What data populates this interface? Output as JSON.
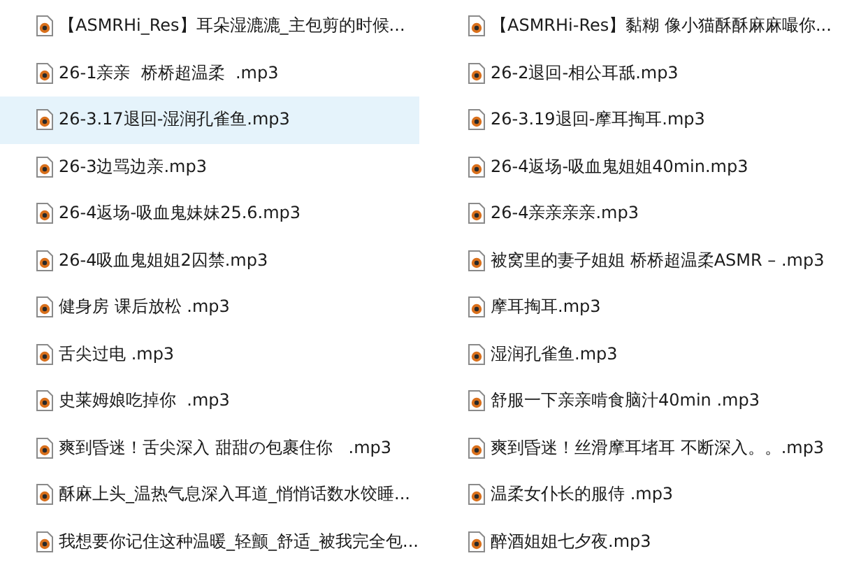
{
  "files": [
    {
      "name": "【ASMRHi_Res】耳朵湿漉漉_主包剪的时候...",
      "selected": false
    },
    {
      "name": "【ASMRHi-Res】黏糊 像小猫酥酥麻麻嘬你...",
      "selected": false
    },
    {
      "name": "26-1亲亲  桥桥超温柔  .mp3",
      "selected": false
    },
    {
      "name": "26-2退回-相公耳舐.mp3",
      "selected": false
    },
    {
      "name": "26-3.17退回-湿润孔雀鱼.mp3",
      "selected": true
    },
    {
      "name": "26-3.19退回-摩耳掏耳.mp3",
      "selected": false
    },
    {
      "name": "26-3边骂边亲.mp3",
      "selected": false
    },
    {
      "name": "26-4返场-吸血鬼姐姐40min.mp3",
      "selected": false
    },
    {
      "name": "26-4返场-吸血鬼妹妹25.6.mp3",
      "selected": false
    },
    {
      "name": "26-4亲亲亲亲.mp3",
      "selected": false
    },
    {
      "name": "26-4吸血鬼姐姐2囚禁.mp3",
      "selected": false
    },
    {
      "name": "被窝里的妻子姐姐 桥桥超温柔ASMR – .mp3",
      "selected": false
    },
    {
      "name": "健身房 课后放松 .mp3",
      "selected": false
    },
    {
      "name": "摩耳掏耳.mp3",
      "selected": false
    },
    {
      "name": "舌尖过电 .mp3",
      "selected": false
    },
    {
      "name": "湿润孔雀鱼.mp3",
      "selected": false
    },
    {
      "name": "史莱姆娘吃掉你  .mp3",
      "selected": false
    },
    {
      "name": "舒服一下亲亲啃食脑汁40min .mp3",
      "selected": false
    },
    {
      "name": "爽到昏迷！舌尖深入 甜甜の包裹住你   .mp3",
      "selected": false
    },
    {
      "name": "爽到昏迷！丝滑摩耳堵耳 不断深入。。.mp3",
      "selected": false
    },
    {
      "name": "酥麻上头_温热气息深入耳道_悄悄话数水饺睡...",
      "selected": false
    },
    {
      "name": "温柔女仆长的服侍 .mp3",
      "selected": false
    },
    {
      "name": "我想要你记住这种温暖_轻颤_舒适_被我完全包...",
      "selected": false
    },
    {
      "name": "醉酒姐姐七夕夜.mp3",
      "selected": false
    }
  ]
}
